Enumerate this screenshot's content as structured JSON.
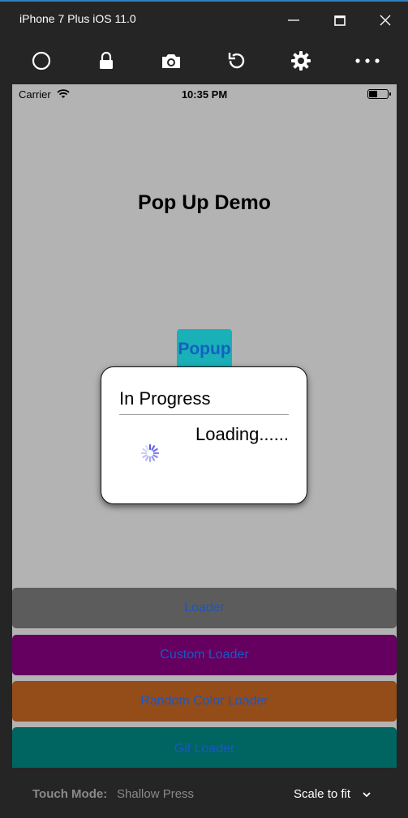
{
  "window": {
    "title": "iPhone 7 Plus iOS 11.0"
  },
  "toolbar": {
    "icons": [
      "home-icon",
      "lock-icon",
      "camera-icon",
      "rotate-icon",
      "settings-icon",
      "more-icon"
    ]
  },
  "statusbar": {
    "carrier": "Carrier",
    "time": "10:35 PM"
  },
  "app": {
    "title": "Pop Up Demo",
    "popup_button": "Popup"
  },
  "dialog": {
    "title": "In Progress",
    "message": "Loading......"
  },
  "buttons": [
    {
      "label": "Loader",
      "color": "#5c5c5c"
    },
    {
      "label": "Custom Loader",
      "color": "#650060"
    },
    {
      "label": "Random Color Loader",
      "color": "#944c18"
    },
    {
      "label": "Gif Loader",
      "color": "#006460"
    }
  ],
  "bottombar": {
    "touch_mode_label": "Touch Mode:",
    "touch_mode_value": "Shallow Press",
    "scale_label": "Scale to fit"
  },
  "colors": {
    "accent_text": "#1a57c4",
    "popup_button_bg": "#1ab0b8",
    "spinner": "#5b5be0"
  }
}
